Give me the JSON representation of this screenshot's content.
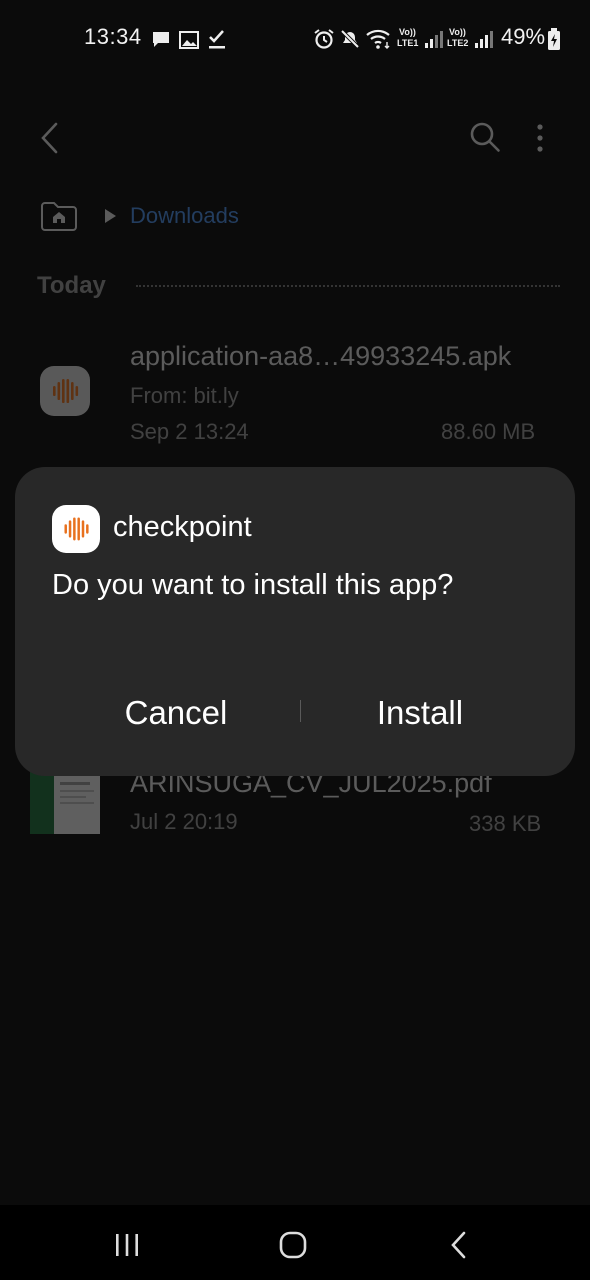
{
  "status_bar": {
    "time": "13:34",
    "battery": "49%",
    "icons": [
      "chat-icon",
      "image-icon",
      "check-icon",
      "alarm-icon",
      "mute-icon",
      "wifi-icon",
      "lte1-signal-icon",
      "lte2-signal-icon",
      "battery-charging-icon"
    ],
    "lte1": "LTE1",
    "lte2": "LTE2",
    "volte": "Vo))"
  },
  "toolbar": {
    "icons": [
      "back-icon",
      "search-icon",
      "more-options-icon"
    ]
  },
  "breadcrumb": {
    "current": "Downloads"
  },
  "section": {
    "title": "Today"
  },
  "files": [
    {
      "name": "application-aa8…49933245.apk",
      "source": "From: bit.ly",
      "date": "Sep 2 13:24",
      "size": "88.60 MB"
    },
    {
      "name": "ARINSUGA_CV_JUL2025.pdf",
      "date": "Jul 2 20:19",
      "size": "338 KB"
    }
  ],
  "dialog": {
    "app_name": "checkpoint",
    "question": "Do you want to install this app?",
    "cancel_label": "Cancel",
    "install_label": "Install",
    "accent": "#e8711e"
  },
  "nav_bar": {
    "icons": [
      "recents-icon",
      "home-icon",
      "back-nav-icon"
    ]
  }
}
